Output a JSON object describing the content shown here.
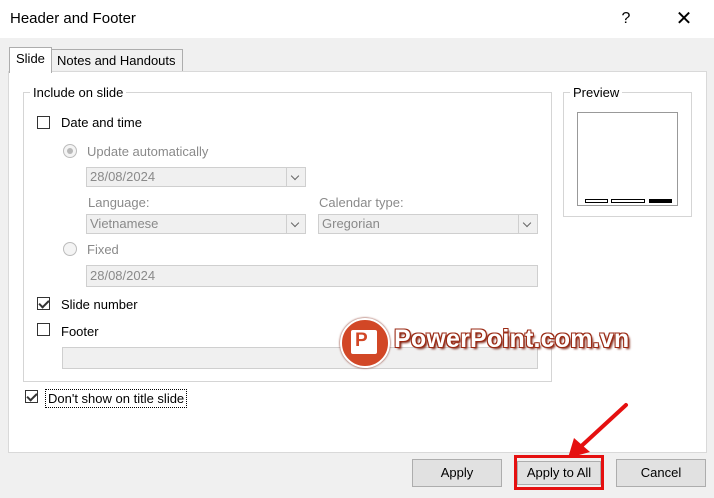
{
  "window": {
    "title": "Header and Footer",
    "help_label": "?",
    "close_label": "✕"
  },
  "tabs": [
    {
      "label": "Slide",
      "active": true
    },
    {
      "label": "Notes and Handouts",
      "active": false
    }
  ],
  "include_group": {
    "label": "Include on slide",
    "date_time": {
      "label": "Date and time",
      "checked": false
    },
    "update_auto": {
      "label": "Update automatically",
      "selected": true
    },
    "update_date": {
      "value": "28/08/2024"
    },
    "language": {
      "label": "Language:",
      "value": "Vietnamese"
    },
    "calendar": {
      "label": "Calendar type:",
      "value": "Gregorian"
    },
    "fixed": {
      "label": "Fixed",
      "selected": false,
      "value": "28/08/2024"
    },
    "slide_number": {
      "label": "Slide number",
      "checked": true
    },
    "footer": {
      "label": "Footer",
      "checked": false,
      "value": ""
    }
  },
  "dont_show": {
    "label": "Don't show on title slide",
    "checked": true
  },
  "preview": {
    "label": "Preview"
  },
  "buttons": {
    "apply": "Apply",
    "apply_all": "Apply to All",
    "cancel": "Cancel"
  },
  "watermark": {
    "brand": "PowerPoint.com.vn",
    "icon_letter": "P"
  },
  "colors": {
    "highlight": "#e51010",
    "brand": "#d24726"
  }
}
